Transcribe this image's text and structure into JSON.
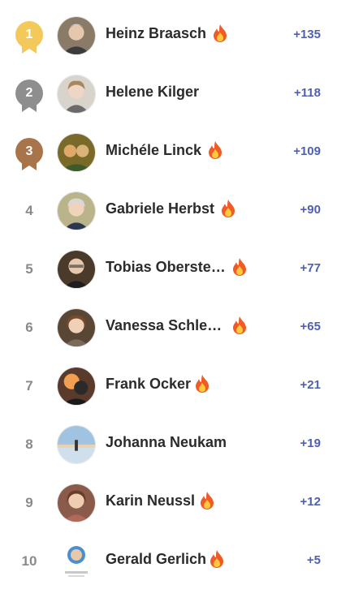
{
  "leaderboard": {
    "rows": [
      {
        "rank": "1",
        "name": "Heinz Braasch",
        "points": "+135",
        "flame": true
      },
      {
        "rank": "2",
        "name": "Helene Kilger",
        "points": "+118",
        "flame": false
      },
      {
        "rank": "3",
        "name": "Michéle Linck",
        "points": "+109",
        "flame": true
      },
      {
        "rank": "4",
        "name": "Gabriele Herbst",
        "points": "+90",
        "flame": true
      },
      {
        "rank": "5",
        "name": "Tobias Oberste…",
        "points": "+77",
        "flame": true
      },
      {
        "rank": "6",
        "name": "Vanessa Schle…",
        "points": "+65",
        "flame": true
      },
      {
        "rank": "7",
        "name": "Frank Ocker",
        "points": "+21",
        "flame": true
      },
      {
        "rank": "8",
        "name": "Johanna Neukam",
        "points": "+19",
        "flame": false
      },
      {
        "rank": "9",
        "name": "Karin Neussl",
        "points": "+12",
        "flame": true
      },
      {
        "rank": "10",
        "name": "Gerald Gerlich",
        "points": "+5",
        "flame": true
      }
    ]
  },
  "colors": {
    "gold": "#f2c95a",
    "silver": "#8e8e8e",
    "bronze": "#a8744a",
    "points": "#4f5fb2",
    "flame_outer": "#f05a24",
    "flame_inner": "#ffc83d"
  },
  "icons": {
    "medal": "medal-icon",
    "flame": "flame-icon"
  }
}
